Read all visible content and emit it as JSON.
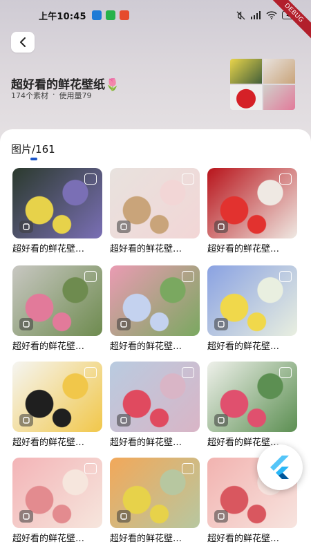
{
  "status_bar": {
    "time": "上午10:45",
    "battery": "47",
    "debug_label": "DEBUG",
    "app_icons": [
      "#1e7bd6",
      "#27b24a",
      "#e64b2d"
    ]
  },
  "header": {
    "back_icon": "chevron-left-icon",
    "title": "超好看的鲜花壁纸🌷",
    "material_count": "174个素材",
    "separator": "·",
    "usage": "使用量79"
  },
  "section": {
    "title": "图片/161",
    "accent": "#1c57c9"
  },
  "cards": [
    {
      "caption": "超好看的鲜花壁…",
      "colors": [
        "#2b3a2d",
        "#e7d24a",
        "#7a6fb5"
      ]
    },
    {
      "caption": "超好看的鲜花壁…",
      "colors": [
        "#e8e2de",
        "#c9a47a",
        "#f2d6d6"
      ]
    },
    {
      "caption": "超好看的鲜花壁…",
      "colors": [
        "#b8141b",
        "#e2322f",
        "#efe9e3"
      ]
    },
    {
      "caption": "超好看的鲜花壁…",
      "colors": [
        "#c8c7c2",
        "#e27a9a",
        "#6e8b4f"
      ]
    },
    {
      "caption": "超好看的鲜花壁…",
      "colors": [
        "#ea9bb3",
        "#c4d2ef",
        "#7aa860"
      ]
    },
    {
      "caption": "超好看的鲜花壁…",
      "colors": [
        "#8aa2e2",
        "#f0d84b",
        "#e9efe0"
      ]
    },
    {
      "caption": "超好看的鲜花壁…",
      "colors": [
        "#f5f5f2",
        "#1f1f1f",
        "#f1c74a"
      ]
    },
    {
      "caption": "超好看的鲜花壁…",
      "colors": [
        "#b9cbe0",
        "#e04a5f",
        "#d9b5c6"
      ]
    },
    {
      "caption": "超好看的鲜花壁…",
      "colors": [
        "#eef0ea",
        "#e0506e",
        "#5c8f52"
      ]
    },
    {
      "caption": "超好看的鲜花壁…",
      "colors": [
        "#f3b4b7",
        "#e38b8f",
        "#f6e6dd"
      ]
    },
    {
      "caption": "超好看的鲜花壁…",
      "colors": [
        "#f2a85a",
        "#e7d24a",
        "#b7c7a0"
      ]
    },
    {
      "caption": "超好看的鲜花壁…",
      "colors": [
        "#f2b3b0",
        "#d9575f",
        "#f7e4df"
      ]
    }
  ],
  "fab_icon": "flutter-logo-icon"
}
